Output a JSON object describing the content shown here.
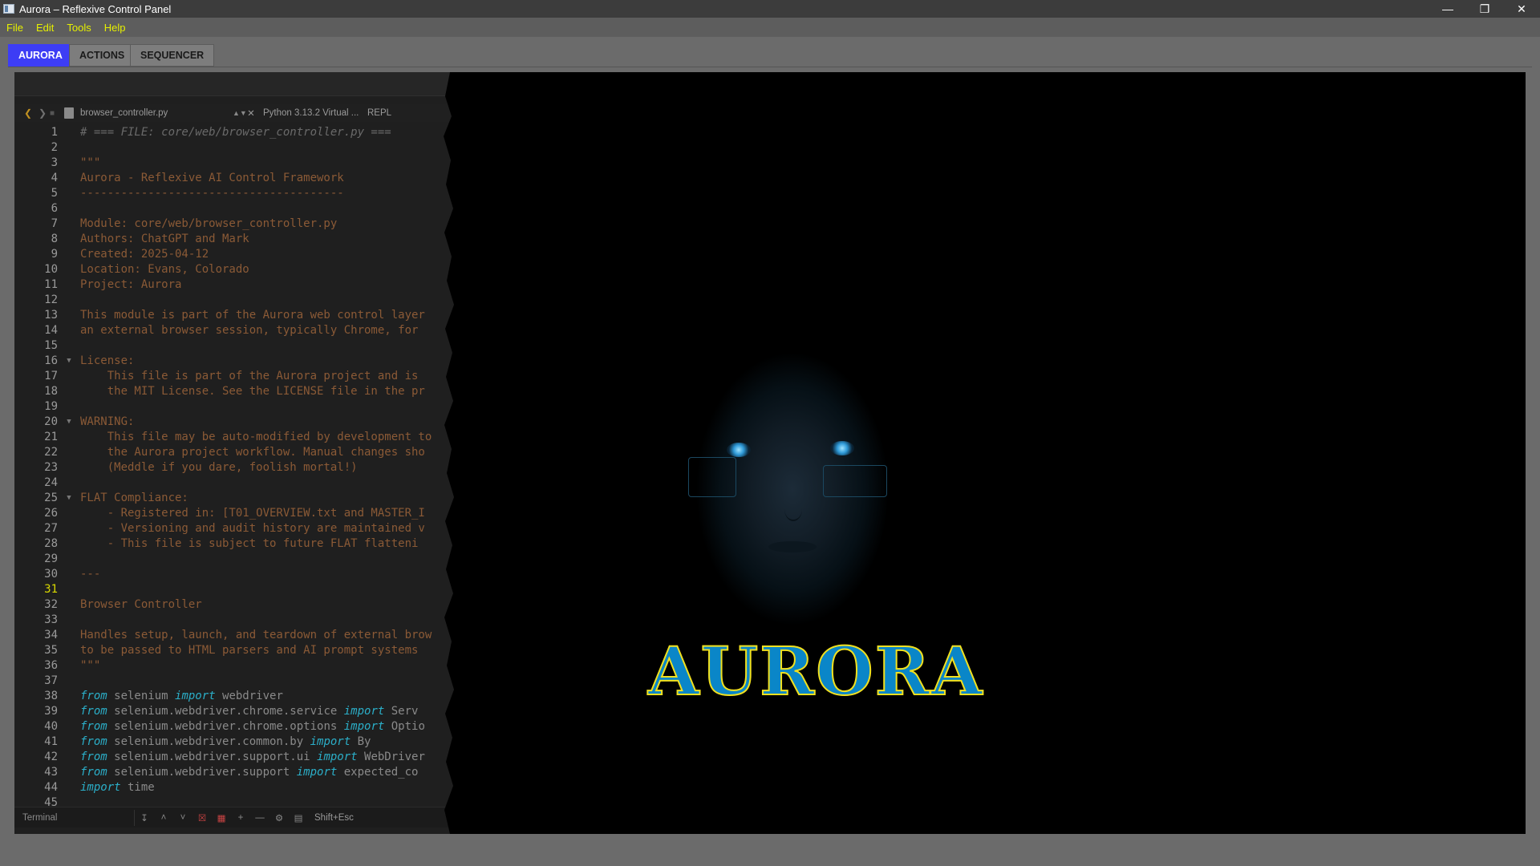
{
  "window": {
    "title": "Aurora – Reflexive Control Panel",
    "controls": {
      "minimize": "—",
      "restore": "❐",
      "close": "✕"
    }
  },
  "menu": [
    "File",
    "Edit",
    "Tools",
    "Help"
  ],
  "tabs": [
    {
      "label": "AURORA",
      "active": true
    },
    {
      "label": "ACTIONS",
      "active": false
    },
    {
      "label": "SEQUENCER",
      "active": false
    }
  ],
  "editor": {
    "file_name": "browser_controller.py",
    "interpreter": "Python 3.13.2 Virtual ...",
    "repl": "REPL",
    "current_line": 31,
    "lines": [
      {
        "n": "1",
        "text": "# === FILE: core/web/browser_controller.py ===",
        "style": "cmt"
      },
      {
        "n": "2",
        "text": "",
        "style": "txt"
      },
      {
        "n": "3",
        "text": "\"\"\"",
        "style": "txt"
      },
      {
        "n": "4",
        "text": "Aurora - Reflexive AI Control Framework",
        "style": "txt"
      },
      {
        "n": "5",
        "text": "---------------------------------------",
        "style": "txt"
      },
      {
        "n": "6",
        "text": "",
        "style": "txt"
      },
      {
        "n": "7",
        "text": "Module: core/web/browser_controller.py",
        "style": "txt"
      },
      {
        "n": "8",
        "text": "Authors: ChatGPT and Mark",
        "style": "txt"
      },
      {
        "n": "9",
        "text": "Created: 2025-04-12",
        "style": "txt"
      },
      {
        "n": "10",
        "text": "Location: Evans, Colorado",
        "style": "txt"
      },
      {
        "n": "11",
        "text": "Project: Aurora",
        "style": "txt"
      },
      {
        "n": "12",
        "text": "",
        "style": "txt"
      },
      {
        "n": "13",
        "text": "This module is part of the Aurora web control layer",
        "style": "txt"
      },
      {
        "n": "14",
        "text": "an external browser session, typically Chrome, for",
        "style": "txt"
      },
      {
        "n": "15",
        "text": "",
        "style": "txt"
      },
      {
        "n": "16",
        "text": "License:",
        "style": "txt",
        "fold": true
      },
      {
        "n": "17",
        "text": "    This file is part of the Aurora project and is",
        "style": "txt"
      },
      {
        "n": "18",
        "text": "    the MIT License. See the LICENSE file in the pr",
        "style": "txt"
      },
      {
        "n": "19",
        "text": "",
        "style": "txt"
      },
      {
        "n": "20",
        "text": "WARNING:",
        "style": "txt",
        "fold": true
      },
      {
        "n": "21",
        "text": "    This file may be auto-modified by development to",
        "style": "txt"
      },
      {
        "n": "22",
        "text": "    the Aurora project workflow. Manual changes sho",
        "style": "txt"
      },
      {
        "n": "23",
        "text": "    (Meddle if you dare, foolish mortal!)",
        "style": "txt"
      },
      {
        "n": "24",
        "text": "",
        "style": "txt"
      },
      {
        "n": "25",
        "text": "FLAT Compliance:",
        "style": "txt",
        "fold": true
      },
      {
        "n": "26",
        "text": "    - Registered in: [T01_OVERVIEW.txt and MASTER_I",
        "style": "txt"
      },
      {
        "n": "27",
        "text": "    - Versioning and audit history are maintained v",
        "style": "txt"
      },
      {
        "n": "28",
        "text": "    - This file is subject to future FLAT flatteni",
        "style": "txt"
      },
      {
        "n": "29",
        "text": "",
        "style": "txt"
      },
      {
        "n": "30",
        "text": "---",
        "style": "txt"
      },
      {
        "n": "31",
        "text": "",
        "style": "txt"
      },
      {
        "n": "32",
        "text": "Browser Controller",
        "style": "txt"
      },
      {
        "n": "33",
        "text": "",
        "style": "txt"
      },
      {
        "n": "34",
        "text": "Handles setup, launch, and teardown of external brow",
        "style": "txt"
      },
      {
        "n": "35",
        "text": "to be passed to HTML parsers and AI prompt systems",
        "style": "txt"
      },
      {
        "n": "36",
        "text": "\"\"\"",
        "style": "txt"
      },
      {
        "n": "37",
        "text": "",
        "style": "txt"
      },
      {
        "n": "38",
        "parts": [
          {
            "t": "from",
            "c": "kw"
          },
          {
            "t": " selenium ",
            "c": "plain"
          },
          {
            "t": "import",
            "c": "kw"
          },
          {
            "t": " webdriver",
            "c": "plain"
          }
        ]
      },
      {
        "n": "39",
        "parts": [
          {
            "t": "from",
            "c": "kw"
          },
          {
            "t": " selenium.webdriver.chrome.service ",
            "c": "plain"
          },
          {
            "t": "import",
            "c": "kw"
          },
          {
            "t": " Serv",
            "c": "plain"
          }
        ]
      },
      {
        "n": "40",
        "parts": [
          {
            "t": "from",
            "c": "kw"
          },
          {
            "t": " selenium.webdriver.chrome.options ",
            "c": "plain"
          },
          {
            "t": "import",
            "c": "kw"
          },
          {
            "t": " Optio",
            "c": "plain"
          }
        ]
      },
      {
        "n": "41",
        "parts": [
          {
            "t": "from",
            "c": "kw"
          },
          {
            "t": " selenium.webdriver.common.by ",
            "c": "plain"
          },
          {
            "t": "import",
            "c": "kw"
          },
          {
            "t": " By",
            "c": "plain"
          }
        ]
      },
      {
        "n": "42",
        "parts": [
          {
            "t": "from",
            "c": "kw"
          },
          {
            "t": " selenium.webdriver.support.ui ",
            "c": "plain"
          },
          {
            "t": "import",
            "c": "kw"
          },
          {
            "t": " WebDriver",
            "c": "plain"
          }
        ]
      },
      {
        "n": "43",
        "parts": [
          {
            "t": "from",
            "c": "kw"
          },
          {
            "t": " selenium.webdriver.support ",
            "c": "plain"
          },
          {
            "t": "import",
            "c": "kw"
          },
          {
            "t": " expected_co",
            "c": "plain"
          }
        ]
      },
      {
        "n": "44",
        "parts": [
          {
            "t": "import",
            "c": "kw"
          },
          {
            "t": " time",
            "c": "plain"
          }
        ]
      },
      {
        "n": "45",
        "text": "",
        "style": "txt"
      }
    ]
  },
  "status": {
    "terminal": "Terminal",
    "shortcut": "Shift+Esc"
  },
  "logo": {
    "text": "AURORA"
  },
  "colors": {
    "accent_tab": "#3d3df5",
    "menu_text": "#e6f000",
    "docstring": "#8b5a36",
    "keyword": "#2bafc9",
    "logo_fill": "#0a86c8",
    "logo_outline": "#f0e020"
  }
}
